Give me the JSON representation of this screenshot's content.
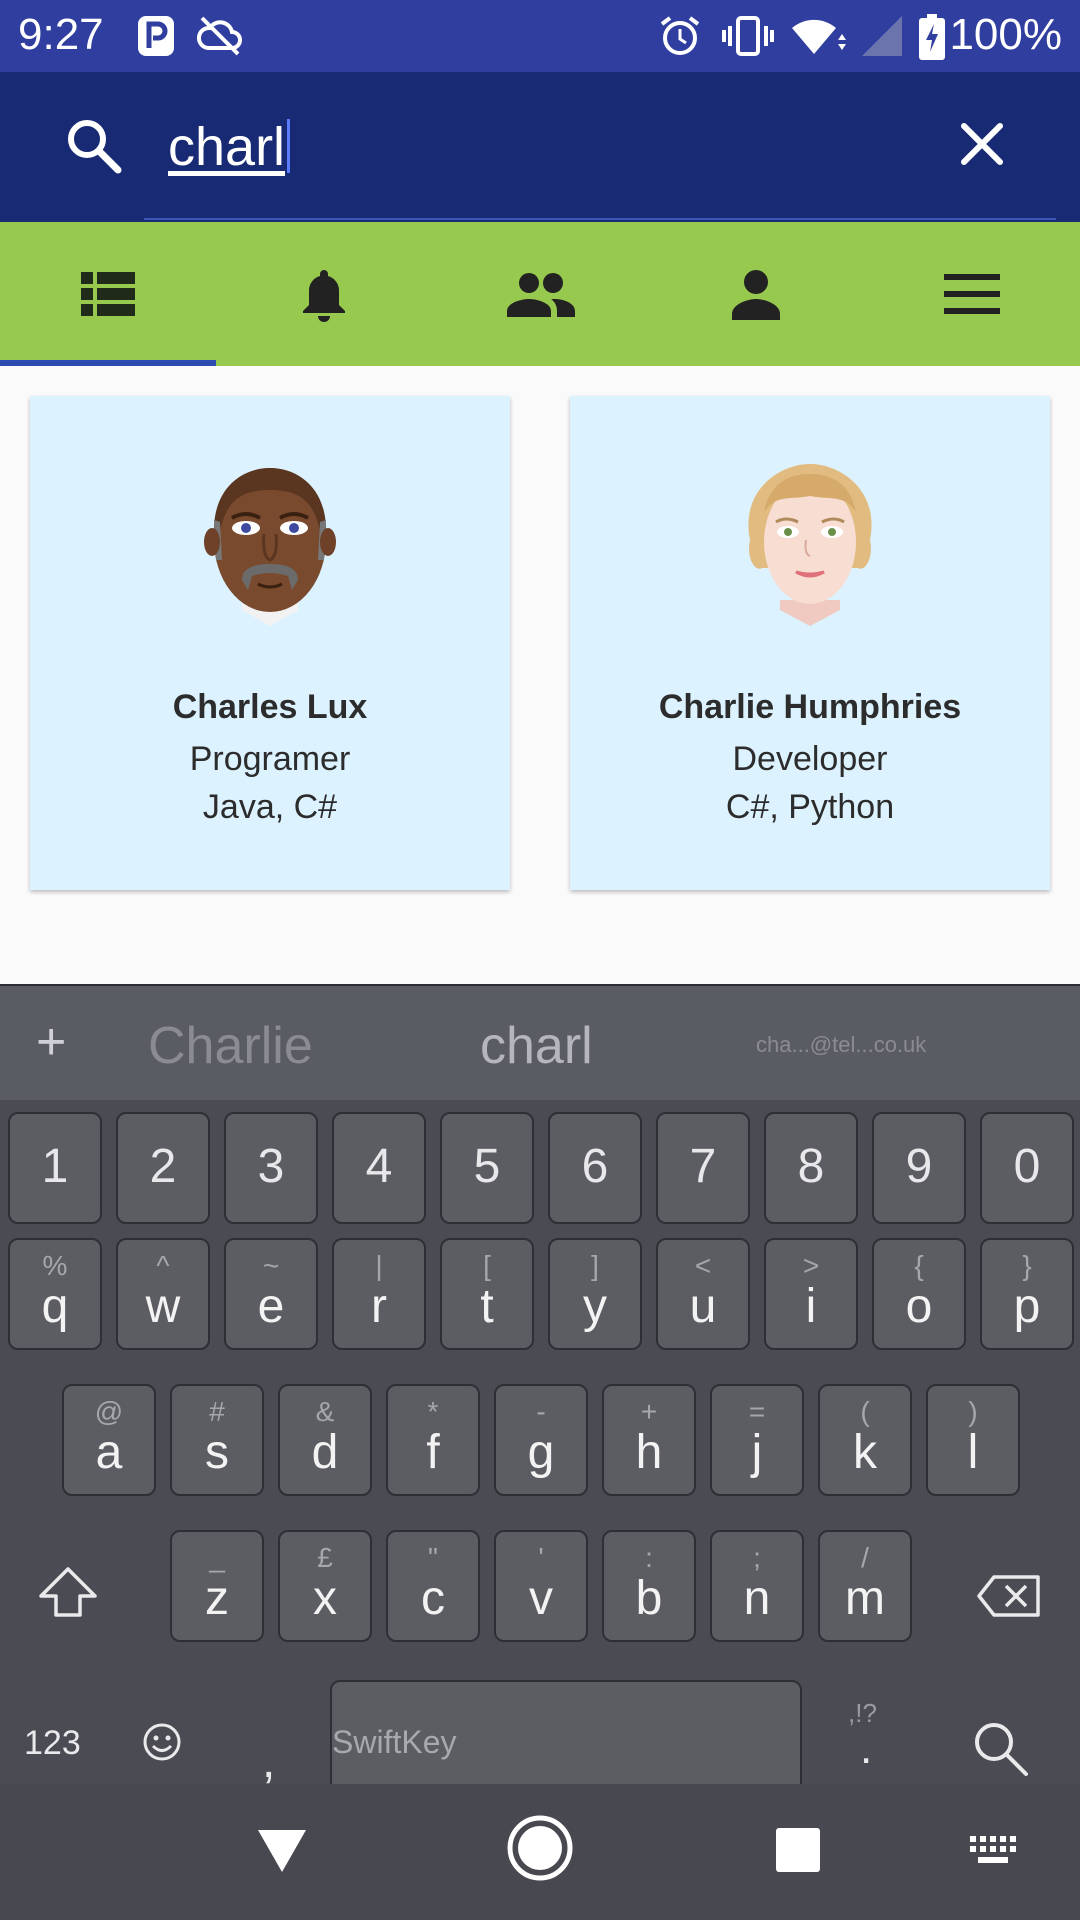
{
  "status_bar": {
    "time": "9:27",
    "battery": "100%"
  },
  "search": {
    "query": "charl"
  },
  "tabs": [
    {
      "name": "list",
      "active": true
    },
    {
      "name": "notifications",
      "active": false
    },
    {
      "name": "group",
      "active": false
    },
    {
      "name": "person",
      "active": false
    },
    {
      "name": "menu",
      "active": false
    }
  ],
  "results": [
    {
      "name": "Charles Lux",
      "role": "Programer",
      "skills": "Java,  C#"
    },
    {
      "name": "Charlie Humphries",
      "role": "Developer",
      "skills": "C#, Python"
    }
  ],
  "keyboard": {
    "suggestions": [
      "Charlie",
      "charl",
      "cha...@tel...co.uk"
    ],
    "number_row": [
      "1",
      "2",
      "3",
      "4",
      "5",
      "6",
      "7",
      "8",
      "9",
      "0"
    ],
    "row1": [
      {
        "main": "q",
        "sub": "%"
      },
      {
        "main": "w",
        "sub": "^"
      },
      {
        "main": "e",
        "sub": "~"
      },
      {
        "main": "r",
        "sub": "|"
      },
      {
        "main": "t",
        "sub": "["
      },
      {
        "main": "y",
        "sub": "]"
      },
      {
        "main": "u",
        "sub": "<"
      },
      {
        "main": "i",
        "sub": ">"
      },
      {
        "main": "o",
        "sub": "{"
      },
      {
        "main": "p",
        "sub": "}"
      }
    ],
    "row2": [
      {
        "main": "a",
        "sub": "@"
      },
      {
        "main": "s",
        "sub": "#"
      },
      {
        "main": "d",
        "sub": "&"
      },
      {
        "main": "f",
        "sub": "*"
      },
      {
        "main": "g",
        "sub": "-"
      },
      {
        "main": "h",
        "sub": "+"
      },
      {
        "main": "j",
        "sub": "="
      },
      {
        "main": "k",
        "sub": "("
      },
      {
        "main": "l",
        "sub": ")"
      }
    ],
    "row3": [
      {
        "main": "z",
        "sub": "_"
      },
      {
        "main": "x",
        "sub": "£"
      },
      {
        "main": "c",
        "sub": "\""
      },
      {
        "main": "v",
        "sub": "'"
      },
      {
        "main": "b",
        "sub": ":"
      },
      {
        "main": "n",
        "sub": ";"
      },
      {
        "main": "m",
        "sub": "/"
      }
    ],
    "numbers_label": "123",
    "comma": ",",
    "period_alt": ",!?",
    "period": ".",
    "space_brand": "SwiftKey"
  }
}
